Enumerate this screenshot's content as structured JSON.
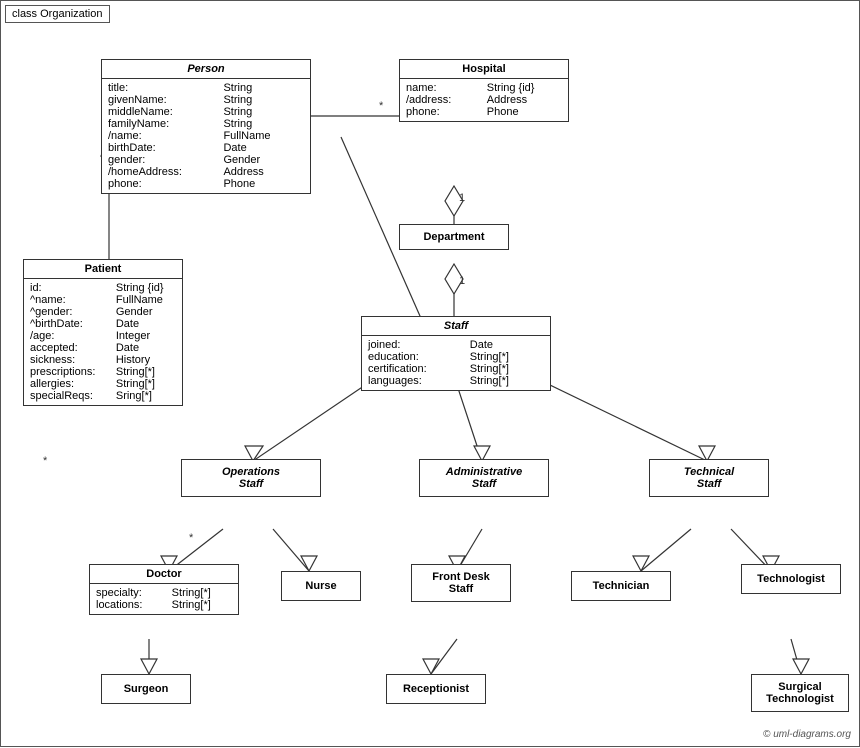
{
  "diagram": {
    "label": "class Organization",
    "copyright": "© uml-diagrams.org",
    "boxes": {
      "person": {
        "title": "Person",
        "attrs": [
          [
            "title:",
            "String"
          ],
          [
            "givenName:",
            "String"
          ],
          [
            "middleName:",
            "String"
          ],
          [
            "familyName:",
            "String"
          ],
          [
            "/name:",
            "FullName"
          ],
          [
            "birthDate:",
            "Date"
          ],
          [
            "gender:",
            "Gender"
          ],
          [
            "/homeAddress:",
            "Address"
          ],
          [
            "phone:",
            "Phone"
          ]
        ]
      },
      "hospital": {
        "title": "Hospital",
        "attrs": [
          [
            "name:",
            "String {id}"
          ],
          [
            "/address:",
            "Address"
          ],
          [
            "phone:",
            "Phone"
          ]
        ]
      },
      "department": {
        "title": "Department",
        "attrs": []
      },
      "staff": {
        "title": "Staff",
        "attrs": [
          [
            "joined:",
            "Date"
          ],
          [
            "education:",
            "String[*]"
          ],
          [
            "certification:",
            "String[*]"
          ],
          [
            "languages:",
            "String[*]"
          ]
        ]
      },
      "patient": {
        "title": "Patient",
        "attrs": [
          [
            "id:",
            "String {id}"
          ],
          [
            "^name:",
            "FullName"
          ],
          [
            "^gender:",
            "Gender"
          ],
          [
            "^birthDate:",
            "Date"
          ],
          [
            "/age:",
            "Integer"
          ],
          [
            "accepted:",
            "Date"
          ],
          [
            "sickness:",
            "History"
          ],
          [
            "prescriptions:",
            "String[*]"
          ],
          [
            "allergies:",
            "String[*]"
          ],
          [
            "specialReqs:",
            "Sring[*]"
          ]
        ]
      },
      "ops_staff": {
        "title": "Operations\nStaff",
        "italic": true
      },
      "admin_staff": {
        "title": "Administrative\nStaff",
        "italic": true
      },
      "tech_staff": {
        "title": "Technical\nStaff",
        "italic": true
      },
      "doctor": {
        "title": "Doctor",
        "attrs": [
          [
            "specialty:",
            "String[*]"
          ],
          [
            "locations:",
            "String[*]"
          ]
        ]
      },
      "nurse": {
        "title": "Nurse",
        "simple": true
      },
      "front_desk": {
        "title": "Front Desk\nStaff",
        "simple": true
      },
      "technician": {
        "title": "Technician",
        "simple": true
      },
      "technologist": {
        "title": "Technologist",
        "simple": true
      },
      "surgeon": {
        "title": "Surgeon",
        "simple": true
      },
      "receptionist": {
        "title": "Receptionist",
        "simple": true
      },
      "surgical_tech": {
        "title": "Surgical\nTechnologist",
        "simple": true
      }
    }
  }
}
